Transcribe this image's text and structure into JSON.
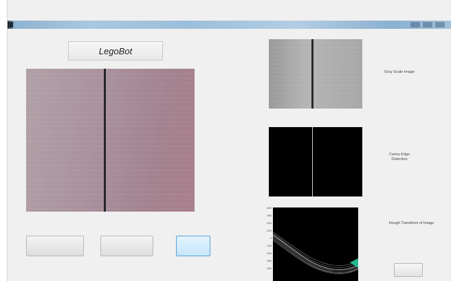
{
  "window": {
    "accent": "#a9c7e0"
  },
  "app": {
    "title": "LegoBot"
  },
  "buttons": {
    "btn1": "",
    "btn2": "",
    "btn3": "",
    "small": ""
  },
  "labels": {
    "gray": "Gray Scale Image",
    "canny": "Canny Edge Detection",
    "hough": "Hough Transform of Image"
  },
  "hough_axis": [
    "",
    ""
  ]
}
